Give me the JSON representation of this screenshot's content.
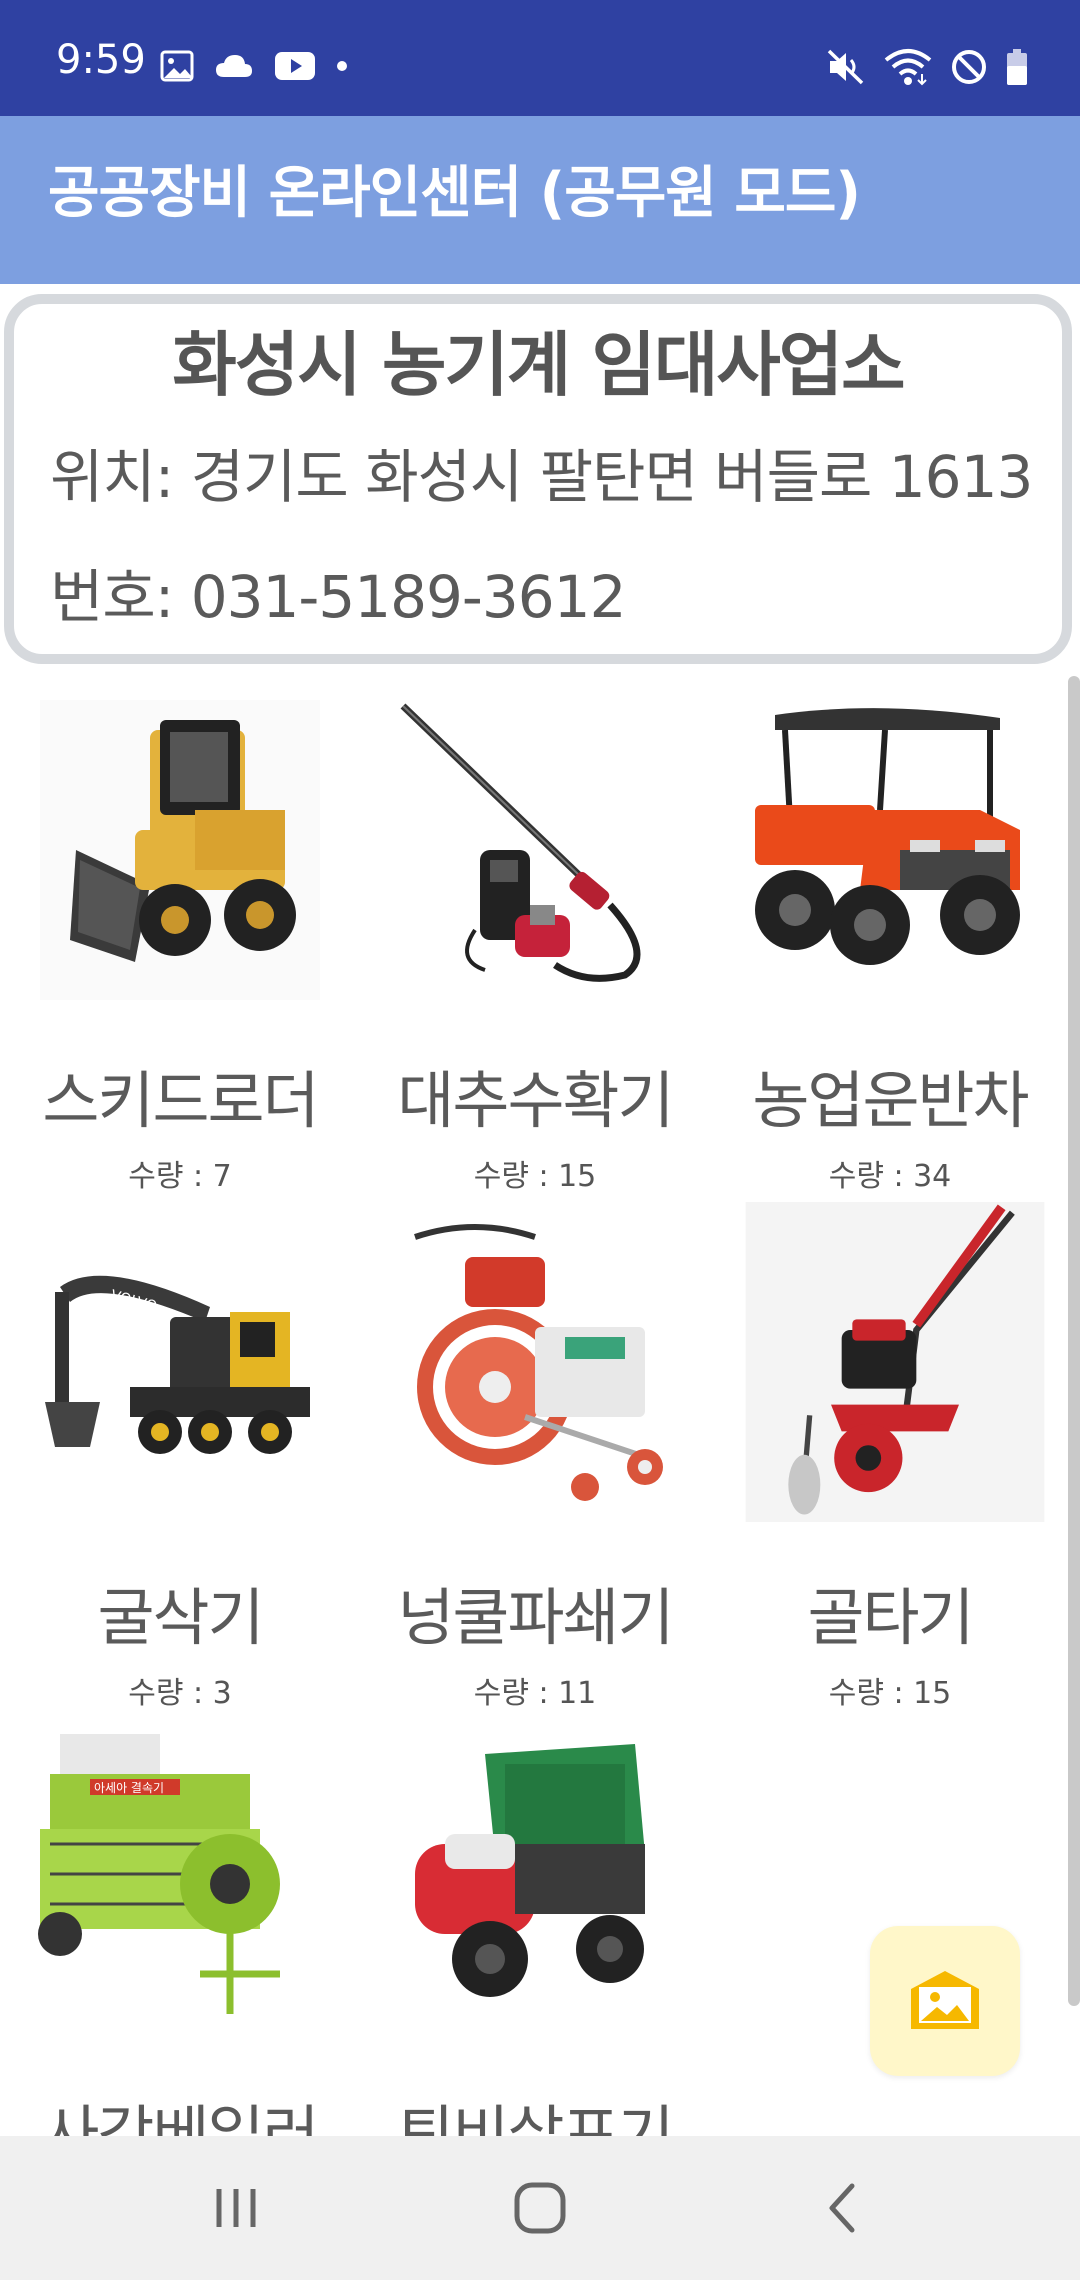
{
  "status_bar": {
    "time": "9:59",
    "left_icons": [
      "gallery-icon",
      "cloud-icon",
      "youtube-icon",
      "dot-icon"
    ],
    "right_icons": [
      "mute-icon",
      "wifi-icon",
      "block-icon",
      "battery-icon"
    ]
  },
  "app_bar": {
    "title": "공공장비 온라인센터 (공무원 모드)"
  },
  "office": {
    "name": "화성시 농기계 임대사업소",
    "location": "위치: 경기도 화성시 팔탄면 버들로 1613",
    "phone": "번호: 031-5189-3612"
  },
  "equipment": [
    {
      "name": "스키드로더",
      "qty": "수량 : 7",
      "icon": "skid-loader-image"
    },
    {
      "name": "대추수확기",
      "qty": "수량 : 15",
      "icon": "jujube-harvester-image"
    },
    {
      "name": "농업운반차",
      "qty": "수량 : 34",
      "icon": "farm-utility-vehicle-image"
    },
    {
      "name": "굴삭기",
      "qty": "수량 : 3",
      "icon": "excavator-image"
    },
    {
      "name": "넝쿨파쇄기",
      "qty": "수량 : 11",
      "icon": "vine-shredder-image"
    },
    {
      "name": "골타기",
      "qty": "수량 : 15",
      "icon": "furrower-image"
    },
    {
      "name": "사각베일러",
      "icon": "square-baler-image"
    },
    {
      "name": "퇴비살포기",
      "icon": "manure-spreader-image"
    }
  ],
  "fab": {
    "icon": "image-mail-icon",
    "color": "#fff7c9"
  },
  "nav_bar": {
    "buttons": [
      "recent-apps-icon",
      "home-icon",
      "back-icon"
    ]
  },
  "colors": {
    "status_bar": "#2f41a2",
    "app_bar": "#7d9fe0",
    "card_border": "#d6d9dd"
  }
}
